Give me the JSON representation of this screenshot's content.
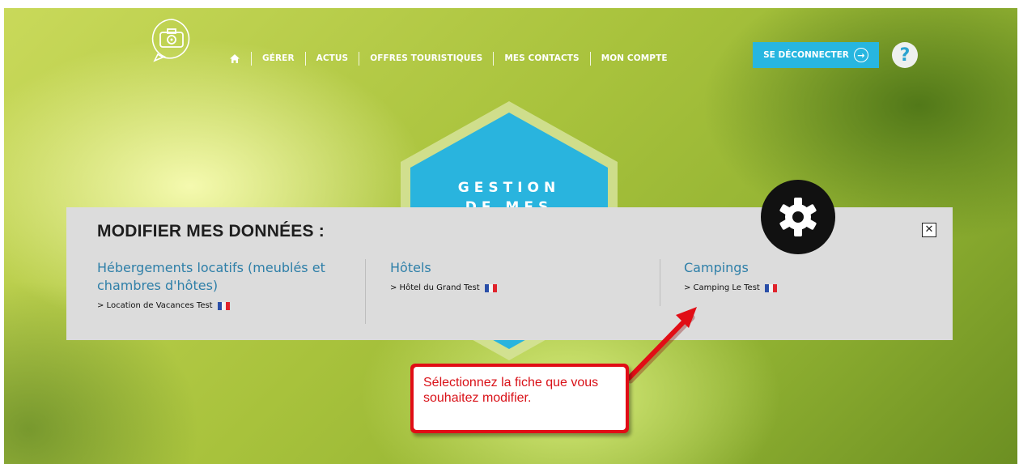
{
  "nav": {
    "home_icon": "home-icon",
    "items": [
      "GÉRER",
      "ACTUS",
      "OFFRES TOURISTIQUES",
      "MES CONTACTS",
      "MON COMPTE"
    ],
    "logout_label": "SE DÉCONNECTER",
    "help_label": "?"
  },
  "hero": {
    "line1": "GESTION",
    "line2": "DE MES"
  },
  "panel": {
    "title": "MODIFIER MES DONNÉES :",
    "close_label": "✕",
    "columns": [
      {
        "category": "Hébergements locatifs (meublés et chambres d'hôtes)",
        "link": "> Location de Vacances Test"
      },
      {
        "category": "Hôtels",
        "link": "> Hôtel du Grand Test"
      },
      {
        "category": "Campings",
        "link": "> Camping Le Test"
      }
    ]
  },
  "callout": {
    "text": "Sélectionnez la fiche que vous souhaitez modifier."
  },
  "colors": {
    "accent": "#27b6e0",
    "category_text": "#2e7fa8",
    "callout_red": "#e10d16"
  }
}
